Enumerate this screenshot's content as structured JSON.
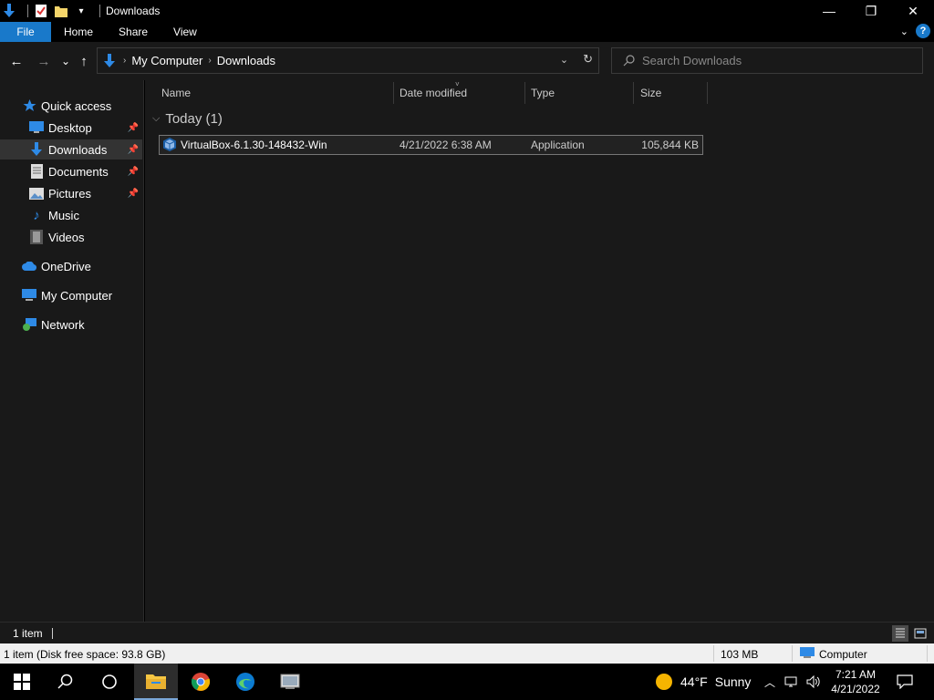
{
  "window": {
    "title": "Downloads",
    "controls": {
      "minimize": "—",
      "maximize": "❐",
      "close": "✕"
    }
  },
  "ribbon": {
    "tabs": [
      "File",
      "Home",
      "Share",
      "View"
    ],
    "help": "?"
  },
  "navbar": {
    "back": "←",
    "forward": "→",
    "recent": "⌄",
    "up": "↑",
    "breadcrumbs": [
      "My Computer",
      "Downloads"
    ],
    "refresh": "↻",
    "search_placeholder": "Search Downloads"
  },
  "sidebar": {
    "items": [
      {
        "label": "Quick access",
        "icon": "star-icon"
      },
      {
        "label": "Desktop",
        "icon": "desktop-icon",
        "pinned": true
      },
      {
        "label": "Downloads",
        "icon": "download-icon",
        "pinned": true,
        "selected": true
      },
      {
        "label": "Documents",
        "icon": "documents-icon",
        "pinned": true
      },
      {
        "label": "Pictures",
        "icon": "pictures-icon",
        "pinned": true
      },
      {
        "label": "Music",
        "icon": "music-icon"
      },
      {
        "label": "Videos",
        "icon": "videos-icon"
      },
      {
        "label": "OneDrive",
        "icon": "cloud-icon"
      },
      {
        "label": "My Computer",
        "icon": "computer-icon"
      },
      {
        "label": "Network",
        "icon": "network-icon"
      }
    ]
  },
  "content": {
    "columns": [
      "Name",
      "Date modified",
      "Type",
      "Size"
    ],
    "group_label": "Today (1)",
    "files": [
      {
        "name": "VirtualBox-6.1.30-148432-Win",
        "date": "4/21/2022 6:38 AM",
        "type": "Application",
        "size": "105,844 KB"
      }
    ]
  },
  "statusbar": {
    "item_count": "1 item"
  },
  "infobar": {
    "left": "1 item (Disk free space: 93.8 GB)",
    "size": "103 MB",
    "location": "Computer"
  },
  "taskbar": {
    "weather_temp": "44°F",
    "weather_desc": "Sunny",
    "time": "7:21 AM",
    "date": "4/21/2022"
  },
  "colors": {
    "accent": "#1979ca",
    "background": "#191919",
    "selected": "#333333"
  }
}
